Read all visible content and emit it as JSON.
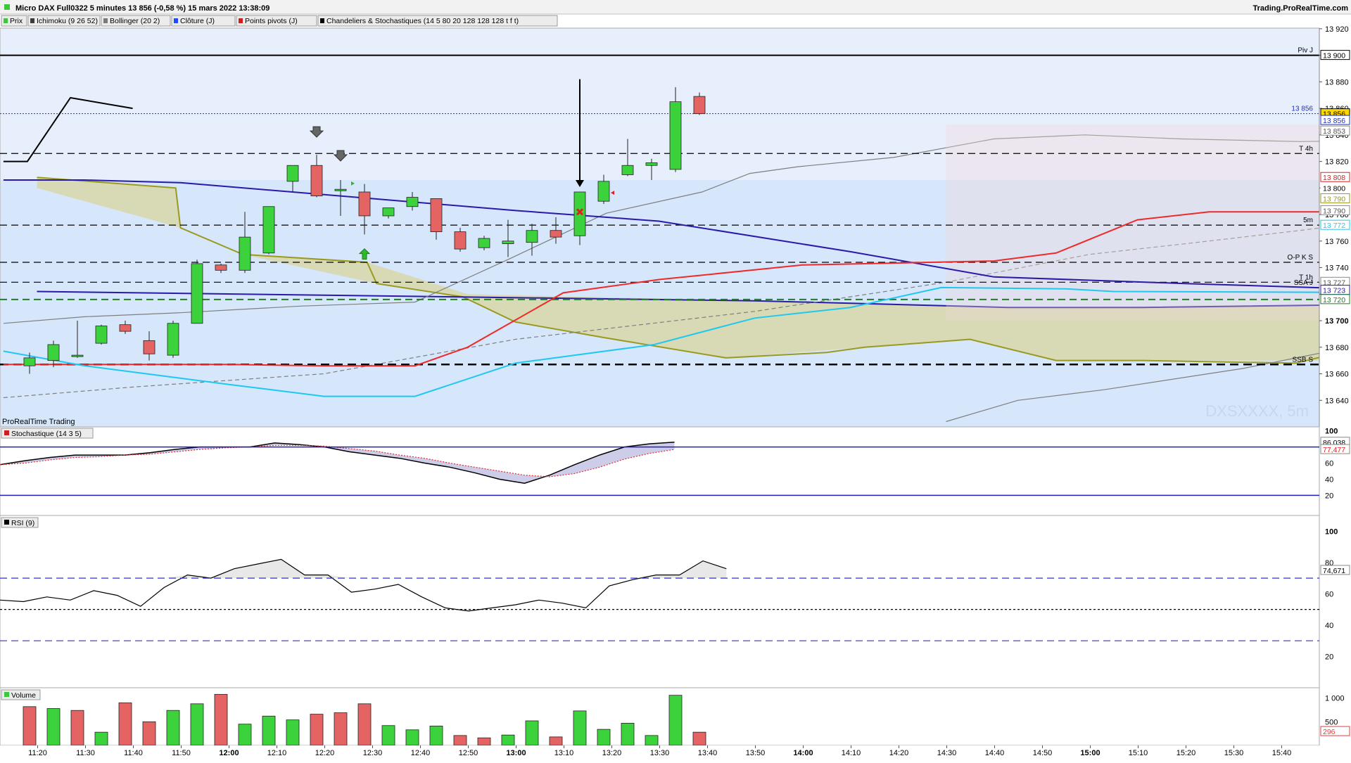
{
  "header": {
    "title": "Micro DAX Full0322 5 minutes 13 856 (-0,58 %) 15 mars 2022 13:38:09",
    "site": "Trading.ProRealTime.com"
  },
  "legend_tabs": [
    {
      "label": "Prix",
      "color": "#3cc83c"
    },
    {
      "label": "Ichimoku (9 26 52)",
      "color": "#3b3b3b"
    },
    {
      "label": "Bollinger (20 2)",
      "color": "#7a7a7a"
    },
    {
      "label": "Clôture (J)",
      "color": "#1e4bff"
    },
    {
      "label": "Points pivots (J)",
      "color": "#cc2020"
    },
    {
      "label": "Chandeliers & Stochastiques (14 5 80 20 128 128 128 t f t)",
      "color": "#000000"
    }
  ],
  "panels": {
    "price_watermark": "ProRealTime Trading",
    "symbol_watermark": "DXSXXXX, 5m",
    "stoch_label": "Stochastique (14 3 5)",
    "rsi_label": "RSI (9)",
    "volume_label": "Volume"
  },
  "colors": {
    "bull": "#3cd23c",
    "bear": "#e46464",
    "kijun": "#2a1aa8",
    "tenkan": "#ef2a2a",
    "chikou": "#000000",
    "ssa": "#9a9a1e",
    "cloud_bull": "#8fd9f7",
    "cloud_bear": "#d8d7a8",
    "fast_line": "#1ec8f0",
    "bollinger": "#7f7f7f"
  },
  "chart_data": [
    {
      "type": "candlestick",
      "panel": "price",
      "ylim": [
        13620,
        13930
      ],
      "yticks": [
        "13 920",
        "13 900",
        "13 880",
        "13 860",
        "13 840",
        "13 820",
        "13 800",
        "13 780",
        "13 760",
        "13 740",
        "13 720",
        "13 700",
        "13 680",
        "13 660",
        "13 640"
      ],
      "time_labels": [
        "11:20",
        "11:30",
        "11:40",
        "11:50",
        "12:00",
        "12:10",
        "12:20",
        "12:30",
        "12:40",
        "12:50",
        "13:00",
        "13:10",
        "13:20",
        "13:30",
        "13:40",
        "13:50",
        "14:00",
        "14:10",
        "14:20",
        "14:30",
        "14:40",
        "14:50",
        "15:00",
        "15:10",
        "15:20",
        "15:30",
        "15:40"
      ],
      "bold_time_labels": [
        "12:00",
        "13:00",
        "14:00",
        "15:00"
      ],
      "candles": [
        {
          "o": 13666,
          "h": 13676,
          "l": 13660,
          "c": 13672
        },
        {
          "o": 13670,
          "h": 13685,
          "l": 13665,
          "c": 13682
        },
        {
          "o": 13674,
          "h": 13700,
          "l": 13672,
          "c": 13674
        },
        {
          "o": 13683,
          "h": 13697,
          "l": 13682,
          "c": 13696
        },
        {
          "o": 13697,
          "h": 13700,
          "l": 13690,
          "c": 13692
        },
        {
          "o": 13685,
          "h": 13692,
          "l": 13670,
          "c": 13675
        },
        {
          "o": 13674,
          "h": 13700,
          "l": 13672,
          "c": 13698
        },
        {
          "o": 13698,
          "h": 13746,
          "l": 13698,
          "c": 13743
        },
        {
          "o": 13742,
          "h": 13743,
          "l": 13736,
          "c": 13738
        },
        {
          "o": 13738,
          "h": 13782,
          "l": 13736,
          "c": 13763
        },
        {
          "o": 13751,
          "h": 13781,
          "l": 13750,
          "c": 13786
        },
        {
          "o": 13805,
          "h": 13817,
          "l": 13797,
          "c": 13817
        },
        {
          "o": 13817,
          "h": 13825,
          "l": 13793,
          "c": 13794
        },
        {
          "o": 13799,
          "h": 13806,
          "l": 13779,
          "c": 13799
        },
        {
          "o": 13797,
          "h": 13803,
          "l": 13765,
          "c": 13779
        },
        {
          "o": 13779,
          "h": 13784,
          "l": 13777,
          "c": 13785
        },
        {
          "o": 13786,
          "h": 13797,
          "l": 13783,
          "c": 13793
        },
        {
          "o": 13792,
          "h": 13792,
          "l": 13761,
          "c": 13767
        },
        {
          "o": 13767,
          "h": 13770,
          "l": 13752,
          "c": 13754
        },
        {
          "o": 13755,
          "h": 13764,
          "l": 13753,
          "c": 13762
        },
        {
          "o": 13758,
          "h": 13776,
          "l": 13748,
          "c": 13760
        },
        {
          "o": 13759,
          "h": 13773,
          "l": 13749,
          "c": 13768
        },
        {
          "o": 13768,
          "h": 13778,
          "l": 13758,
          "c": 13763
        },
        {
          "o": 13764,
          "h": 13779,
          "l": 13757,
          "c": 13797
        },
        {
          "o": 13790,
          "h": 13810,
          "l": 13788,
          "c": 13805
        },
        {
          "o": 13810,
          "h": 13837,
          "l": 13809,
          "c": 13817
        },
        {
          "o": 13817,
          "h": 13822,
          "l": 13806,
          "c": 13819
        },
        {
          "o": 13814,
          "h": 13876,
          "l": 13812,
          "c": 13865
        },
        {
          "o": 13869,
          "h": 13872,
          "l": 13855,
          "c": 13856
        }
      ],
      "price_lines": {
        "Piv J": 13900,
        "T 4h": 13826,
        "5m": 13772,
        "O-P K S": 13744,
        "T 1h": 13729,
        "SSB S": 13667
      },
      "right_badges": [
        {
          "text": "13 900",
          "bg": "#ffffff",
          "fg": "#000",
          "border": "#000",
          "value": 13900
        },
        {
          "text": "13 856",
          "bg": "#ffd700",
          "fg": "#000",
          "border": "#000",
          "value": 13856
        },
        {
          "text": "13 856",
          "bg": "#ffffff",
          "fg": "#2030c0",
          "border": "#2030c0",
          "value": 13851
        },
        {
          "text": "13 853",
          "bg": "#ffffff",
          "fg": "#555",
          "border": "#888",
          "value": 13843
        },
        {
          "text": "13 808",
          "bg": "#ffffff",
          "fg": "#e02020",
          "border": "#e02020",
          "value": 13808
        },
        {
          "text": "13 800",
          "bg": "#ffffff",
          "fg": "#000",
          "border": "#ffffff",
          "value": 13800
        },
        {
          "text": "13 790",
          "bg": "#ffffff",
          "fg": "#9a9a1e",
          "border": "#9a9a1e",
          "value": 13792
        },
        {
          "text": "13 790",
          "bg": "#ffffff",
          "fg": "#555",
          "border": "#888",
          "value": 13783
        },
        {
          "text": "13 772",
          "bg": "#ffffff",
          "fg": "#1ec8f0",
          "border": "#1ec8f0",
          "value": 13772
        },
        {
          "text": "13 727",
          "bg": "#ffffff",
          "fg": "#555",
          "border": "#888",
          "value": 13729
        },
        {
          "text": "13 723",
          "bg": "#ffffff",
          "fg": "#2a1aa8",
          "border": "#2a1aa8",
          "value": 13723
        },
        {
          "text": "13 720",
          "bg": "#ffffff",
          "fg": "#208020",
          "border": "#208020",
          "value": 13716
        }
      ],
      "right_labels": [
        {
          "text": "13 856",
          "value": 13856,
          "color": "#2030c0"
        },
        {
          "text": "SSA J",
          "value": 13725,
          "color": "#000"
        }
      ]
    },
    {
      "type": "line",
      "panel": "stochastic",
      "yticks": [
        "100",
        "80",
        "60",
        "40",
        "20"
      ],
      "values_k": [
        58,
        63,
        67,
        70,
        70,
        70,
        73,
        77,
        80,
        80,
        80,
        85,
        83,
        80,
        74,
        70,
        66,
        60,
        55,
        48,
        40,
        35,
        45,
        58,
        70,
        80,
        84,
        86
      ],
      "values_d": [
        58,
        60,
        64,
        67,
        68,
        70,
        71,
        74,
        77,
        79,
        80,
        82,
        82,
        81,
        78,
        75,
        70,
        66,
        60,
        55,
        50,
        45,
        43,
        47,
        55,
        65,
        72,
        77
      ],
      "last_k": "86,038",
      "last_d": "77,477",
      "levels": [
        80,
        20
      ]
    },
    {
      "type": "line",
      "panel": "rsi",
      "yticks": [
        "100",
        "80",
        "60",
        "40",
        "20"
      ],
      "values": [
        56,
        55,
        58,
        56,
        62,
        59,
        52,
        64,
        72,
        70,
        76,
        79,
        82,
        72,
        72,
        61,
        63,
        66,
        58,
        51,
        49,
        51,
        53,
        56,
        54,
        51,
        65,
        69,
        72,
        72,
        81,
        76
      ],
      "last": "74,671",
      "levels": [
        70,
        50,
        30
      ]
    },
    {
      "type": "bar",
      "panel": "volume",
      "yticks": [
        "1 000",
        "500"
      ],
      "ylim": [
        0,
        1100
      ],
      "values": [
        820,
        780,
        740,
        280,
        900,
        500,
        740,
        880,
        1080,
        450,
        620,
        540,
        660,
        690,
        880,
        420,
        330,
        410,
        210,
        160,
        220,
        520,
        180,
        730,
        340,
        470,
        210,
        1060,
        280
      ],
      "up": [
        0,
        1,
        0,
        1,
        0,
        0,
        1,
        1,
        0,
        1,
        1,
        1,
        0,
        0,
        0,
        1,
        1,
        1,
        0,
        0,
        1,
        1,
        0,
        1,
        1,
        1,
        1,
        1,
        0
      ],
      "last_up": "296",
      "last_label": "?"
    }
  ]
}
